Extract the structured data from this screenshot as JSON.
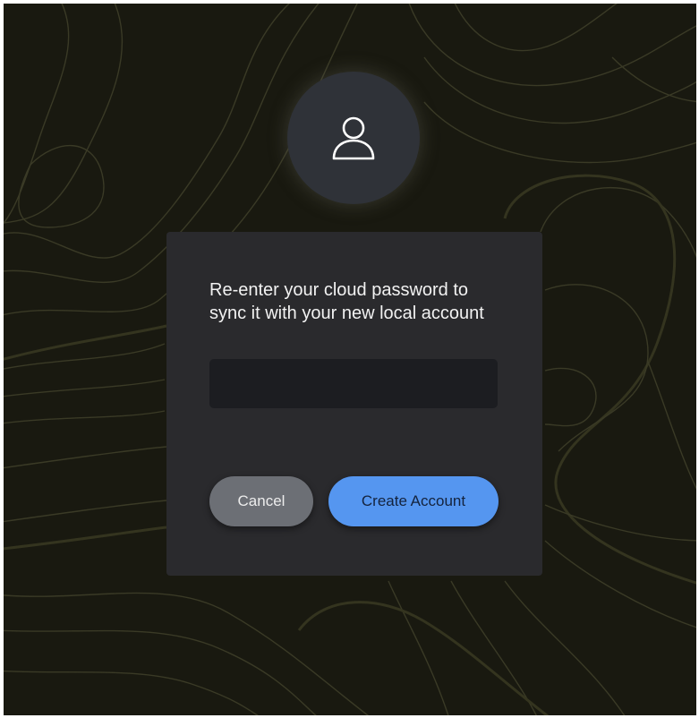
{
  "dialog": {
    "prompt": "Re-enter your cloud password to sync it with your new local account",
    "password_field": {
      "value": "",
      "placeholder": ""
    },
    "cancel_label": "Cancel",
    "create_label": "Create Account"
  },
  "icons": {
    "avatar": "user-icon"
  },
  "colors": {
    "background": "#191910",
    "topo_lines": "#3a3a26",
    "card": "#2a2a2d",
    "avatar": "#2f3238",
    "input": "#1c1d21",
    "cancel_button": "#6c6f75",
    "primary_button": "#5596f0"
  }
}
